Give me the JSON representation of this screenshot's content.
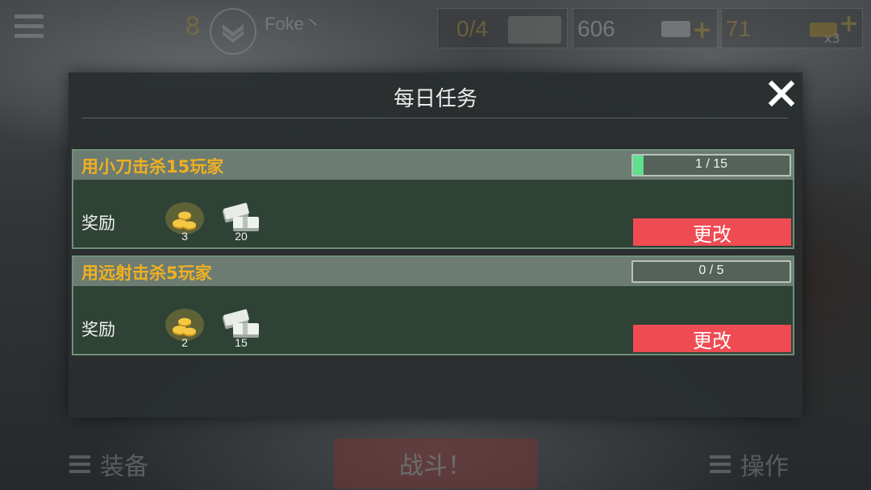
{
  "topbar": {
    "level": "8",
    "player_name": "Foke丶",
    "tickets": "0/4",
    "cash": "606",
    "gold": "71",
    "gold_multiplier": "x3"
  },
  "bottombar": {
    "equipment_label": "装备",
    "fight_label": "战斗！",
    "controls_label": "操作"
  },
  "modal": {
    "title": "每日任务",
    "tasks": [
      {
        "title": "用小刀击杀15玩家",
        "progress_text": "1 / 15",
        "progress": 0.0667,
        "reward_label": "奖励",
        "rewards": [
          {
            "icon": "gold-coins-icon",
            "count": "3"
          },
          {
            "icon": "cash-stack-icon",
            "count": "20"
          }
        ],
        "change_label": "更改"
      },
      {
        "title": "用远射击杀5玩家",
        "progress_text": "0 / 5",
        "progress": 0,
        "reward_label": "奖励",
        "rewards": [
          {
            "icon": "gold-coins-icon",
            "count": "2"
          },
          {
            "icon": "cash-stack-icon",
            "count": "15"
          }
        ],
        "change_label": "更改"
      }
    ]
  },
  "colors": {
    "accent_gold": "#f0b020",
    "change_button": "#ef4b53",
    "progress_fill": "#5fe08c",
    "card_bg": "#2f4236"
  }
}
